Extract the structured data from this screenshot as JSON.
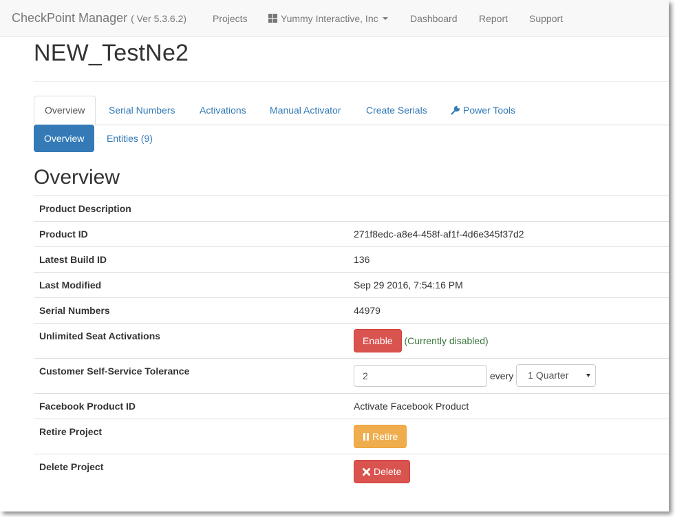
{
  "navbar": {
    "brand": "CheckPoint Manager",
    "version": "( Ver 5.3.6.2)",
    "projects": "Projects",
    "company": "Yummy Interactive, Inc",
    "dashboard": "Dashboard",
    "report": "Report",
    "support": "Support"
  },
  "page_title": "NEW_TestNe2",
  "tabs": [
    "Overview",
    "Serial Numbers",
    "Activations",
    "Manual Activator",
    "Create Serials",
    "Power Tools"
  ],
  "pills": [
    "Overview",
    "Entities (9)"
  ],
  "section_title": "Overview",
  "rows": {
    "product_description": {
      "label": "Product Description",
      "value": ""
    },
    "product_id": {
      "label": "Product ID",
      "value": "271f8edc-a8e4-458f-af1f-4d6e345f37d2"
    },
    "latest_build": {
      "label": "Latest Build ID",
      "value": "136"
    },
    "last_modified": {
      "label": "Last Modified",
      "value": "Sep 29 2016, 7:54:16 PM"
    },
    "serial_numbers": {
      "label": "Serial Numbers",
      "value": "44979"
    },
    "unlimited": {
      "label": "Unlimited Seat Activations",
      "button": "Enable",
      "status": "(Currently disabled)"
    },
    "tolerance": {
      "label": "Customer Self-Service Tolerance",
      "input_value": "2",
      "every": "every",
      "period": "1 Quarter"
    },
    "facebook": {
      "label": "Facebook Product ID",
      "link": "Activate Facebook Product"
    },
    "retire": {
      "label": "Retire Project",
      "button": "Retire"
    },
    "delete": {
      "label": "Delete Project",
      "button": "Delete"
    }
  },
  "colors": {
    "link": "#337ab7",
    "primary": "#337ab7",
    "danger": "#d9534f",
    "warning": "#f0ad4e",
    "success_text": "#3c763d"
  }
}
